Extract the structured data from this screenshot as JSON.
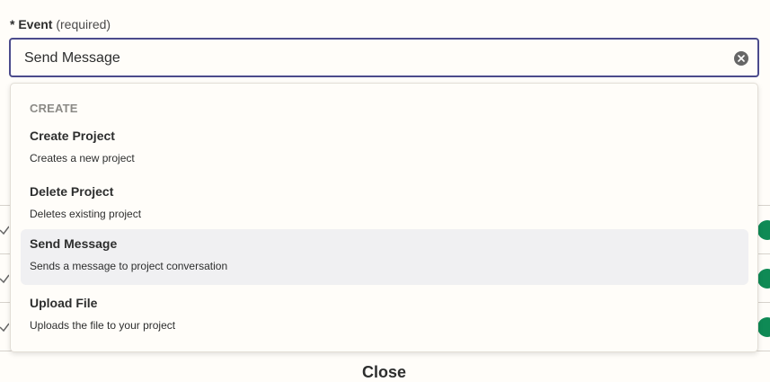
{
  "field": {
    "required_marker": "*",
    "label": "Event",
    "hint": "(required)",
    "value": "Send Message"
  },
  "dropdown": {
    "group_title": "CREATE",
    "options": [
      {
        "title": "Create Project",
        "description": "Creates a new project"
      },
      {
        "title": "Delete Project",
        "description": "Deletes existing project"
      },
      {
        "title": "Send Message",
        "description": "Sends a message to project conversation",
        "selected": true
      },
      {
        "title": "Upload File",
        "description": "Uploads the file to your project"
      }
    ]
  },
  "background": {
    "close_label": "Close"
  },
  "icons": {
    "clear": "clear-icon",
    "check": "check-icon",
    "status": "status-dot-icon"
  },
  "colors": {
    "focus_border": "#4b4b8c",
    "selected_option_bg": "#f0f0f2",
    "group_title": "#8b8a86",
    "status_green": "#0f8a55"
  }
}
